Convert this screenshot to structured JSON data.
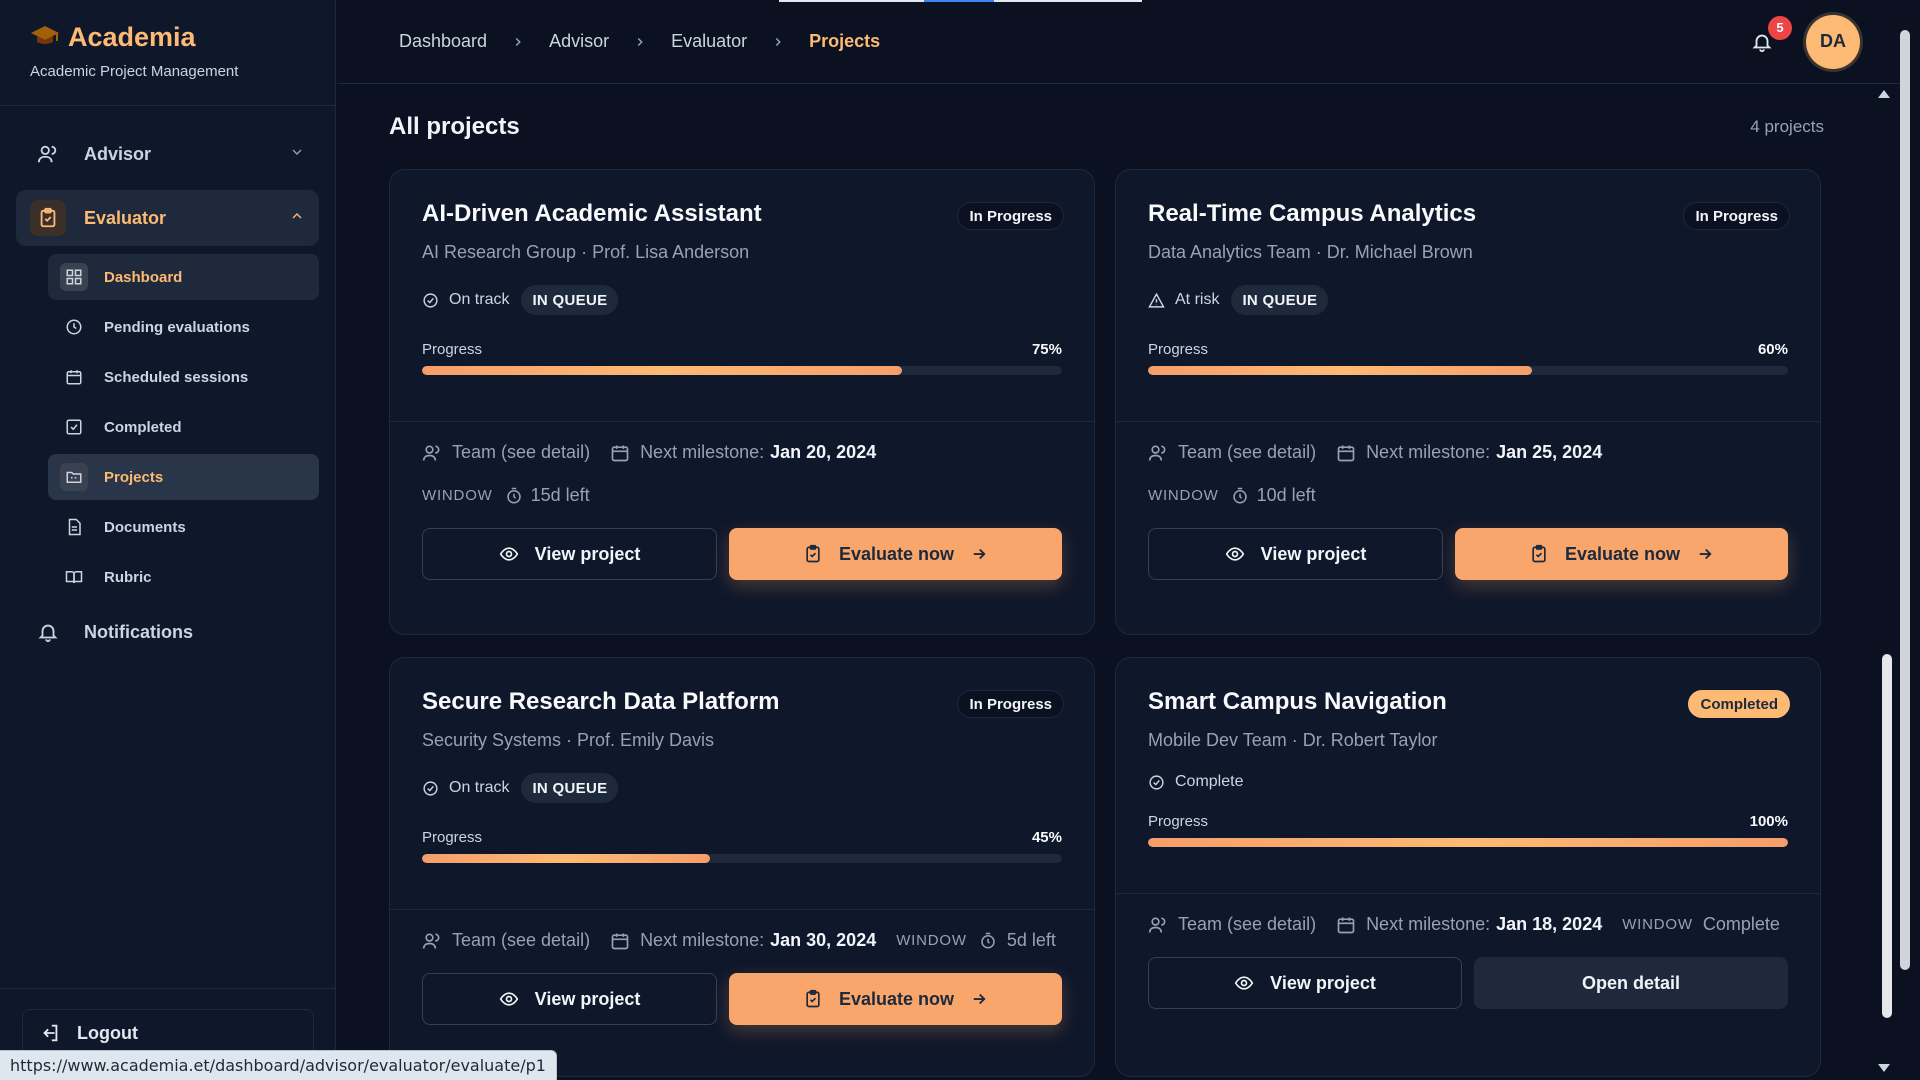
{
  "brand": {
    "title": "Academia",
    "subtitle": "Academic Project Management"
  },
  "sidebar": {
    "advisor_label": "Advisor",
    "evaluator_label": "Evaluator",
    "sub_items": [
      {
        "label": "Dashboard",
        "icon": "grid-icon"
      },
      {
        "label": "Pending evaluations",
        "icon": "clock-icon"
      },
      {
        "label": "Scheduled sessions",
        "icon": "calendar-icon"
      },
      {
        "label": "Completed",
        "icon": "check-square-icon"
      },
      {
        "label": "Projects",
        "icon": "folder-icon"
      },
      {
        "label": "Documents",
        "icon": "document-icon"
      },
      {
        "label": "Rubric",
        "icon": "book-icon"
      }
    ],
    "notifications_label": "Notifications",
    "logout_label": "Logout"
  },
  "breadcrumb": [
    "Dashboard",
    "Advisor",
    "Evaluator",
    "Projects"
  ],
  "header": {
    "notification_count": "5",
    "avatar_initials": "DA"
  },
  "section": {
    "title": "All projects",
    "count": "4 projects"
  },
  "projects": [
    {
      "title": "AI-Driven Academic Assistant",
      "subtitle": "AI Research Group · Prof. Lisa Anderson",
      "status": "In Progress",
      "health": "On track",
      "queue": "IN QUEUE",
      "progress_label": "Progress",
      "progress_text": "75%",
      "progress": 75,
      "team": "Team (see detail)",
      "milestone_label": "Next milestone:",
      "milestone_date": "Jan 20, 2024",
      "window_label": "WINDOW",
      "window_value": "15d left",
      "view_label": "View project",
      "action_label": "Evaluate now"
    },
    {
      "title": "Real-Time Campus Analytics",
      "subtitle": "Data Analytics Team · Dr. Michael Brown",
      "status": "In Progress",
      "health": "At risk",
      "queue": "IN QUEUE",
      "progress_label": "Progress",
      "progress_text": "60%",
      "progress": 60,
      "team": "Team (see detail)",
      "milestone_label": "Next milestone:",
      "milestone_date": "Jan 25, 2024",
      "window_label": "WINDOW",
      "window_value": "10d left",
      "view_label": "View project",
      "action_label": "Evaluate now"
    },
    {
      "title": "Secure Research Data Platform",
      "subtitle": "Security Systems · Prof. Emily Davis",
      "status": "In Progress",
      "health": "On track",
      "queue": "IN QUEUE",
      "progress_label": "Progress",
      "progress_text": "45%",
      "progress": 45,
      "team": "Team (see detail)",
      "milestone_label": "Next milestone:",
      "milestone_date": "Jan 30, 2024",
      "window_label": "WINDOW",
      "window_value": "5d left",
      "view_label": "View project",
      "action_label": "Evaluate now"
    },
    {
      "title": "Smart Campus Navigation",
      "subtitle": "Mobile Dev Team · Dr. Robert Taylor",
      "status": "Completed",
      "health": "Complete",
      "progress_label": "Progress",
      "progress_text": "100%",
      "progress": 100,
      "team": "Team (see detail)",
      "milestone_label": "Next milestone:",
      "milestone_date": "Jan 18, 2024",
      "window_label": "WINDOW",
      "window_value": "Complete",
      "view_label": "View project",
      "action_label": "Open detail"
    }
  ],
  "status_url": "https://www.academia.et/dashboard/advisor/evaluator/evaluate/p1"
}
